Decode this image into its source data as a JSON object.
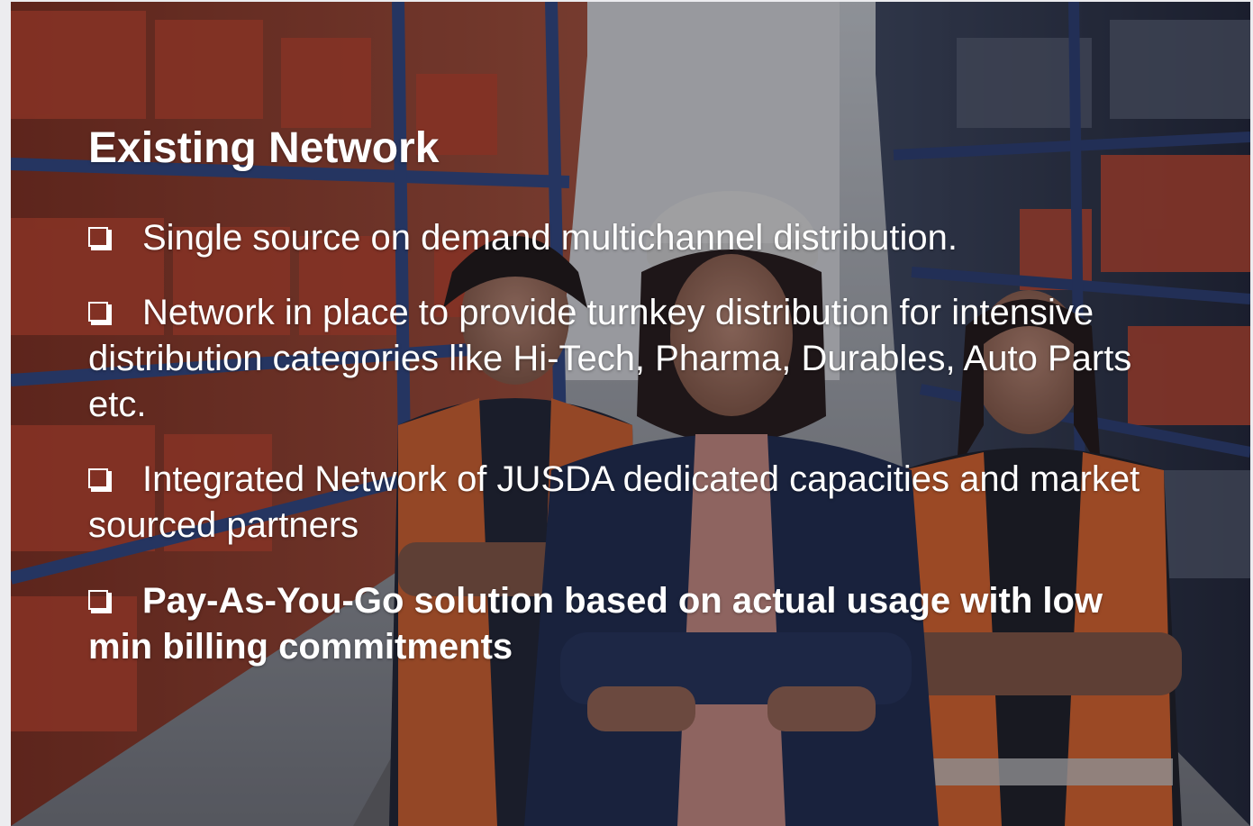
{
  "slide": {
    "title": "Existing Network",
    "background_image": "warehouse-workers-photo",
    "text_color": "#ffffff",
    "bullet_icon": "checkbox-square-icon",
    "bullets": [
      {
        "text": "Single source on demand multichannel distribution.",
        "bold": false
      },
      {
        "text": "Network in place to provide turnkey distribution for intensive distribution categories like Hi-Tech, Pharma, Durables, Auto Parts etc.",
        "bold": false
      },
      {
        "text": "Integrated Network of JUSDA dedicated capacities and market sourced partners",
        "bold": false
      },
      {
        "text": "Pay-As-You-Go solution based on actual usage with low min billing commitments",
        "bold": true
      }
    ]
  }
}
